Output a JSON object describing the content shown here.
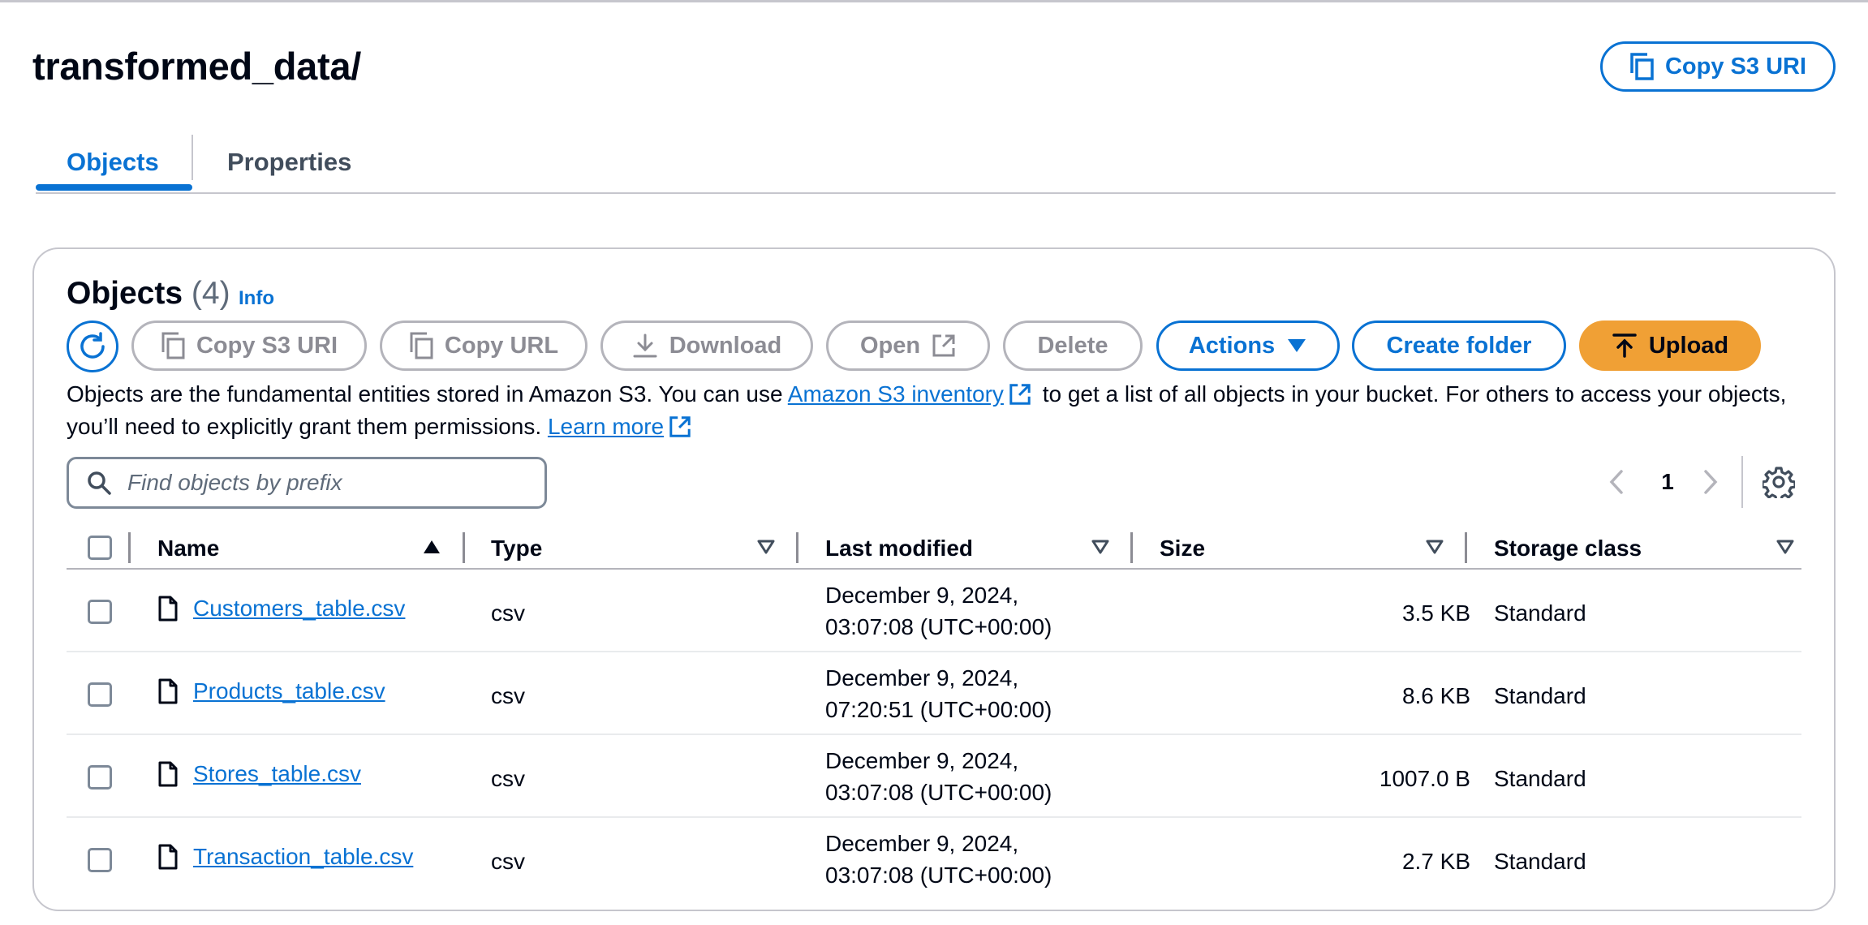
{
  "page": {
    "title": "transformed_data/",
    "copy_s3_uri_label": "Copy S3 URI"
  },
  "tabs": [
    {
      "label": "Objects",
      "active": true
    },
    {
      "label": "Properties",
      "active": false
    }
  ],
  "objects_panel": {
    "title": "Objects",
    "count": "(4)",
    "info_label": "Info",
    "toolbar": {
      "copy_s3_uri": "Copy S3 URI",
      "copy_url": "Copy URL",
      "download": "Download",
      "open": "Open",
      "delete": "Delete",
      "actions": "Actions",
      "create_folder": "Create folder",
      "upload": "Upload"
    },
    "description": {
      "part1": "Objects are the fundamental entities stored in Amazon S3. You can use ",
      "link1": "Amazon S3 inventory",
      "part2": " to get a list of all objects in your bucket. For others to access your objects, you’ll need to explicitly grant them permissions. ",
      "link2": "Learn more"
    },
    "search": {
      "placeholder": "Find objects by prefix",
      "value": ""
    },
    "pagination": {
      "current_page": "1"
    },
    "columns": [
      "Name",
      "Type",
      "Last modified",
      "Size",
      "Storage class"
    ],
    "rows": [
      {
        "name": "Customers_table.csv",
        "type": "csv",
        "modified_date": "December 9, 2024,",
        "modified_time": "03:07:08 (UTC+00:00)",
        "size": "3.5 KB",
        "storage_class": "Standard"
      },
      {
        "name": "Products_table.csv",
        "type": "csv",
        "modified_date": "December 9, 2024,",
        "modified_time": "07:20:51 (UTC+00:00)",
        "size": "8.6 KB",
        "storage_class": "Standard"
      },
      {
        "name": "Stores_table.csv",
        "type": "csv",
        "modified_date": "December 9, 2024,",
        "modified_time": "03:07:08 (UTC+00:00)",
        "size": "1007.0 B",
        "storage_class": "Standard"
      },
      {
        "name": "Transaction_table.csv",
        "type": "csv",
        "modified_date": "December 9, 2024,",
        "modified_time": "03:07:08 (UTC+00:00)",
        "size": "2.7 KB",
        "storage_class": "Standard"
      }
    ]
  },
  "colors": {
    "link_blue": "#0972d3",
    "upload_orange": "#f0a035",
    "disabled_gray": "#8c8c94"
  }
}
